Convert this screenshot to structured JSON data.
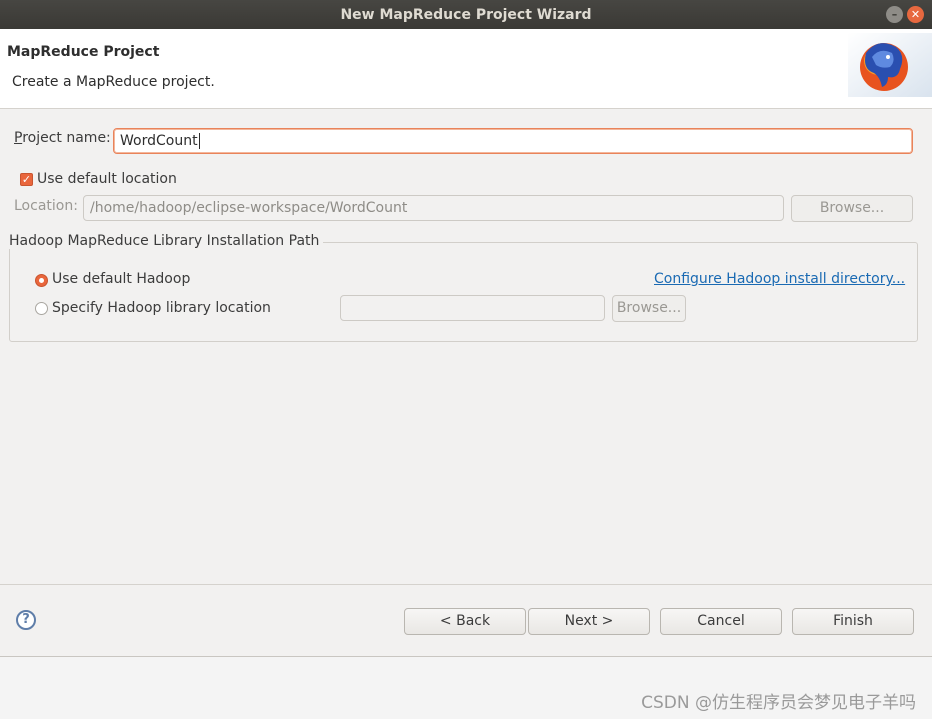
{
  "window": {
    "title": "New MapReduce Project Wizard"
  },
  "header": {
    "title": "MapReduce Project",
    "description": "Create a MapReduce project."
  },
  "project": {
    "name_label": "Project name:",
    "name_value": "WordCount",
    "use_default_location_label": "Use default location",
    "use_default_location_checked": true,
    "location_label": "Location:",
    "location_value": "/home/hadoop/eclipse-workspace/WordCount",
    "browse_label": "Browse..."
  },
  "hadoop_group": {
    "title": "Hadoop MapReduce Library Installation Path",
    "use_default_label": "Use default Hadoop",
    "use_default_selected": true,
    "configure_link": "Configure Hadoop install directory...",
    "specify_label": "Specify Hadoop library location",
    "specify_value": "",
    "browse_label": "Browse..."
  },
  "footer": {
    "help_symbol": "?",
    "back_label": "< Back",
    "next_label": "Next >",
    "cancel_label": "Cancel",
    "finish_label": "Finish"
  },
  "watermark": "CSDN @仿生程序员会梦见电子羊吗",
  "colors": {
    "accent": "#e9663c",
    "link": "#1a6ab3",
    "titlebar": "#3d3c38"
  }
}
